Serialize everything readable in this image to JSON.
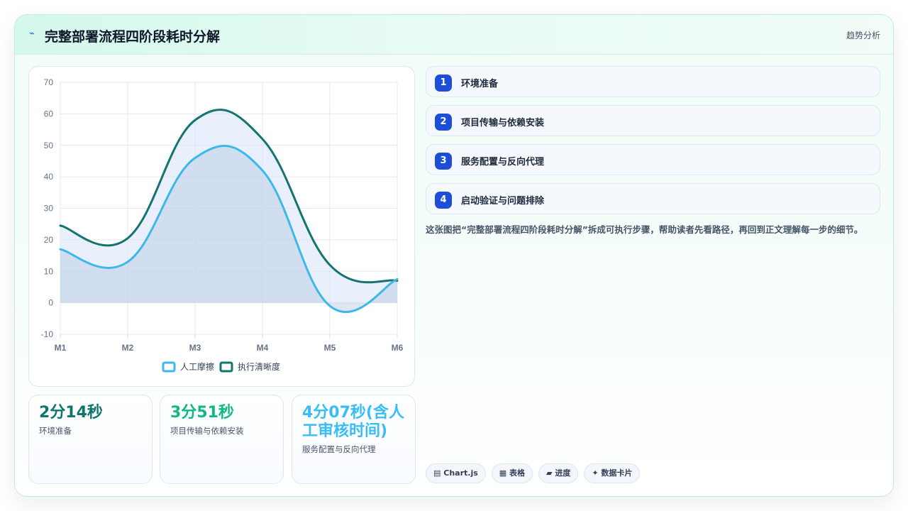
{
  "header": {
    "icon": "chart-line-icon",
    "title": "完整部署流程四阶段耗时分解",
    "tag": "趋势分析"
  },
  "chart_data": {
    "type": "line",
    "categories": [
      "M1",
      "M2",
      "M3",
      "M4",
      "M5",
      "M6"
    ],
    "series": [
      {
        "name": "人工摩擦",
        "values": [
          17,
          13,
          46,
          42,
          -1,
          7.5
        ],
        "color": "#3db8e8",
        "fill": "rgba(180,200,225,0.45)"
      },
      {
        "name": "执行清晰度",
        "values": [
          24.5,
          20.5,
          58,
          52,
          12,
          7
        ],
        "color": "#13756d",
        "fill": "rgba(215,228,250,0.55)"
      }
    ],
    "ylim": [
      -10,
      70
    ],
    "yticks": [
      -10,
      0,
      10,
      20,
      30,
      40,
      50,
      60,
      70
    ],
    "grid": true,
    "legend": "bottom"
  },
  "stats": [
    {
      "value": "2分14秒",
      "label": "环境准备",
      "color": "#0f766e"
    },
    {
      "value": "3分51秒",
      "label": "项目传输与依赖安装",
      "color": "#10b981"
    },
    {
      "value": "4分07秒(含人工审核时间)",
      "label": "服务配置与反向代理",
      "color": "#38bdf8"
    }
  ],
  "steps": [
    {
      "num": "1",
      "text": "环境准备"
    },
    {
      "num": "2",
      "text": "项目传输与依赖安装"
    },
    {
      "num": "3",
      "text": "服务配置与反向代理"
    },
    {
      "num": "4",
      "text": "启动验证与问题排除"
    }
  ],
  "description": "这张图把“完整部署流程四阶段耗时分解”拆成可执行步骤，帮助读者先看路径，再回到正文理解每一步的细节。",
  "chips": [
    {
      "icon": "chart-icon",
      "glyph": "▤",
      "label": "Chart.js"
    },
    {
      "icon": "table-icon",
      "glyph": "▦",
      "label": "表格"
    },
    {
      "icon": "progress-icon",
      "glyph": "▰",
      "label": "进度"
    },
    {
      "icon": "card-icon",
      "glyph": "✦",
      "label": "数据卡片"
    }
  ]
}
